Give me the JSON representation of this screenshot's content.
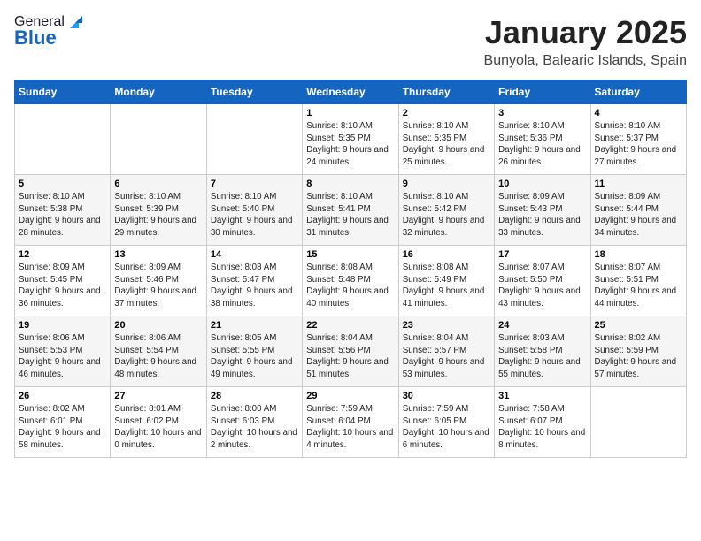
{
  "header": {
    "logo_general": "General",
    "logo_blue": "Blue",
    "month": "January 2025",
    "location": "Bunyola, Balearic Islands, Spain"
  },
  "days_of_week": [
    "Sunday",
    "Monday",
    "Tuesday",
    "Wednesday",
    "Thursday",
    "Friday",
    "Saturday"
  ],
  "weeks": [
    [
      {
        "day": "",
        "info": ""
      },
      {
        "day": "",
        "info": ""
      },
      {
        "day": "",
        "info": ""
      },
      {
        "day": "1",
        "info": "Sunrise: 8:10 AM\nSunset: 5:35 PM\nDaylight: 9 hours and 24 minutes."
      },
      {
        "day": "2",
        "info": "Sunrise: 8:10 AM\nSunset: 5:35 PM\nDaylight: 9 hours and 25 minutes."
      },
      {
        "day": "3",
        "info": "Sunrise: 8:10 AM\nSunset: 5:36 PM\nDaylight: 9 hours and 26 minutes."
      },
      {
        "day": "4",
        "info": "Sunrise: 8:10 AM\nSunset: 5:37 PM\nDaylight: 9 hours and 27 minutes."
      }
    ],
    [
      {
        "day": "5",
        "info": "Sunrise: 8:10 AM\nSunset: 5:38 PM\nDaylight: 9 hours and 28 minutes."
      },
      {
        "day": "6",
        "info": "Sunrise: 8:10 AM\nSunset: 5:39 PM\nDaylight: 9 hours and 29 minutes."
      },
      {
        "day": "7",
        "info": "Sunrise: 8:10 AM\nSunset: 5:40 PM\nDaylight: 9 hours and 30 minutes."
      },
      {
        "day": "8",
        "info": "Sunrise: 8:10 AM\nSunset: 5:41 PM\nDaylight: 9 hours and 31 minutes."
      },
      {
        "day": "9",
        "info": "Sunrise: 8:10 AM\nSunset: 5:42 PM\nDaylight: 9 hours and 32 minutes."
      },
      {
        "day": "10",
        "info": "Sunrise: 8:09 AM\nSunset: 5:43 PM\nDaylight: 9 hours and 33 minutes."
      },
      {
        "day": "11",
        "info": "Sunrise: 8:09 AM\nSunset: 5:44 PM\nDaylight: 9 hours and 34 minutes."
      }
    ],
    [
      {
        "day": "12",
        "info": "Sunrise: 8:09 AM\nSunset: 5:45 PM\nDaylight: 9 hours and 36 minutes."
      },
      {
        "day": "13",
        "info": "Sunrise: 8:09 AM\nSunset: 5:46 PM\nDaylight: 9 hours and 37 minutes."
      },
      {
        "day": "14",
        "info": "Sunrise: 8:08 AM\nSunset: 5:47 PM\nDaylight: 9 hours and 38 minutes."
      },
      {
        "day": "15",
        "info": "Sunrise: 8:08 AM\nSunset: 5:48 PM\nDaylight: 9 hours and 40 minutes."
      },
      {
        "day": "16",
        "info": "Sunrise: 8:08 AM\nSunset: 5:49 PM\nDaylight: 9 hours and 41 minutes."
      },
      {
        "day": "17",
        "info": "Sunrise: 8:07 AM\nSunset: 5:50 PM\nDaylight: 9 hours and 43 minutes."
      },
      {
        "day": "18",
        "info": "Sunrise: 8:07 AM\nSunset: 5:51 PM\nDaylight: 9 hours and 44 minutes."
      }
    ],
    [
      {
        "day": "19",
        "info": "Sunrise: 8:06 AM\nSunset: 5:53 PM\nDaylight: 9 hours and 46 minutes."
      },
      {
        "day": "20",
        "info": "Sunrise: 8:06 AM\nSunset: 5:54 PM\nDaylight: 9 hours and 48 minutes."
      },
      {
        "day": "21",
        "info": "Sunrise: 8:05 AM\nSunset: 5:55 PM\nDaylight: 9 hours and 49 minutes."
      },
      {
        "day": "22",
        "info": "Sunrise: 8:04 AM\nSunset: 5:56 PM\nDaylight: 9 hours and 51 minutes."
      },
      {
        "day": "23",
        "info": "Sunrise: 8:04 AM\nSunset: 5:57 PM\nDaylight: 9 hours and 53 minutes."
      },
      {
        "day": "24",
        "info": "Sunrise: 8:03 AM\nSunset: 5:58 PM\nDaylight: 9 hours and 55 minutes."
      },
      {
        "day": "25",
        "info": "Sunrise: 8:02 AM\nSunset: 5:59 PM\nDaylight: 9 hours and 57 minutes."
      }
    ],
    [
      {
        "day": "26",
        "info": "Sunrise: 8:02 AM\nSunset: 6:01 PM\nDaylight: 9 hours and 58 minutes."
      },
      {
        "day": "27",
        "info": "Sunrise: 8:01 AM\nSunset: 6:02 PM\nDaylight: 10 hours and 0 minutes."
      },
      {
        "day": "28",
        "info": "Sunrise: 8:00 AM\nSunset: 6:03 PM\nDaylight: 10 hours and 2 minutes."
      },
      {
        "day": "29",
        "info": "Sunrise: 7:59 AM\nSunset: 6:04 PM\nDaylight: 10 hours and 4 minutes."
      },
      {
        "day": "30",
        "info": "Sunrise: 7:59 AM\nSunset: 6:05 PM\nDaylight: 10 hours and 6 minutes."
      },
      {
        "day": "31",
        "info": "Sunrise: 7:58 AM\nSunset: 6:07 PM\nDaylight: 10 hours and 8 minutes."
      },
      {
        "day": "",
        "info": ""
      }
    ]
  ]
}
